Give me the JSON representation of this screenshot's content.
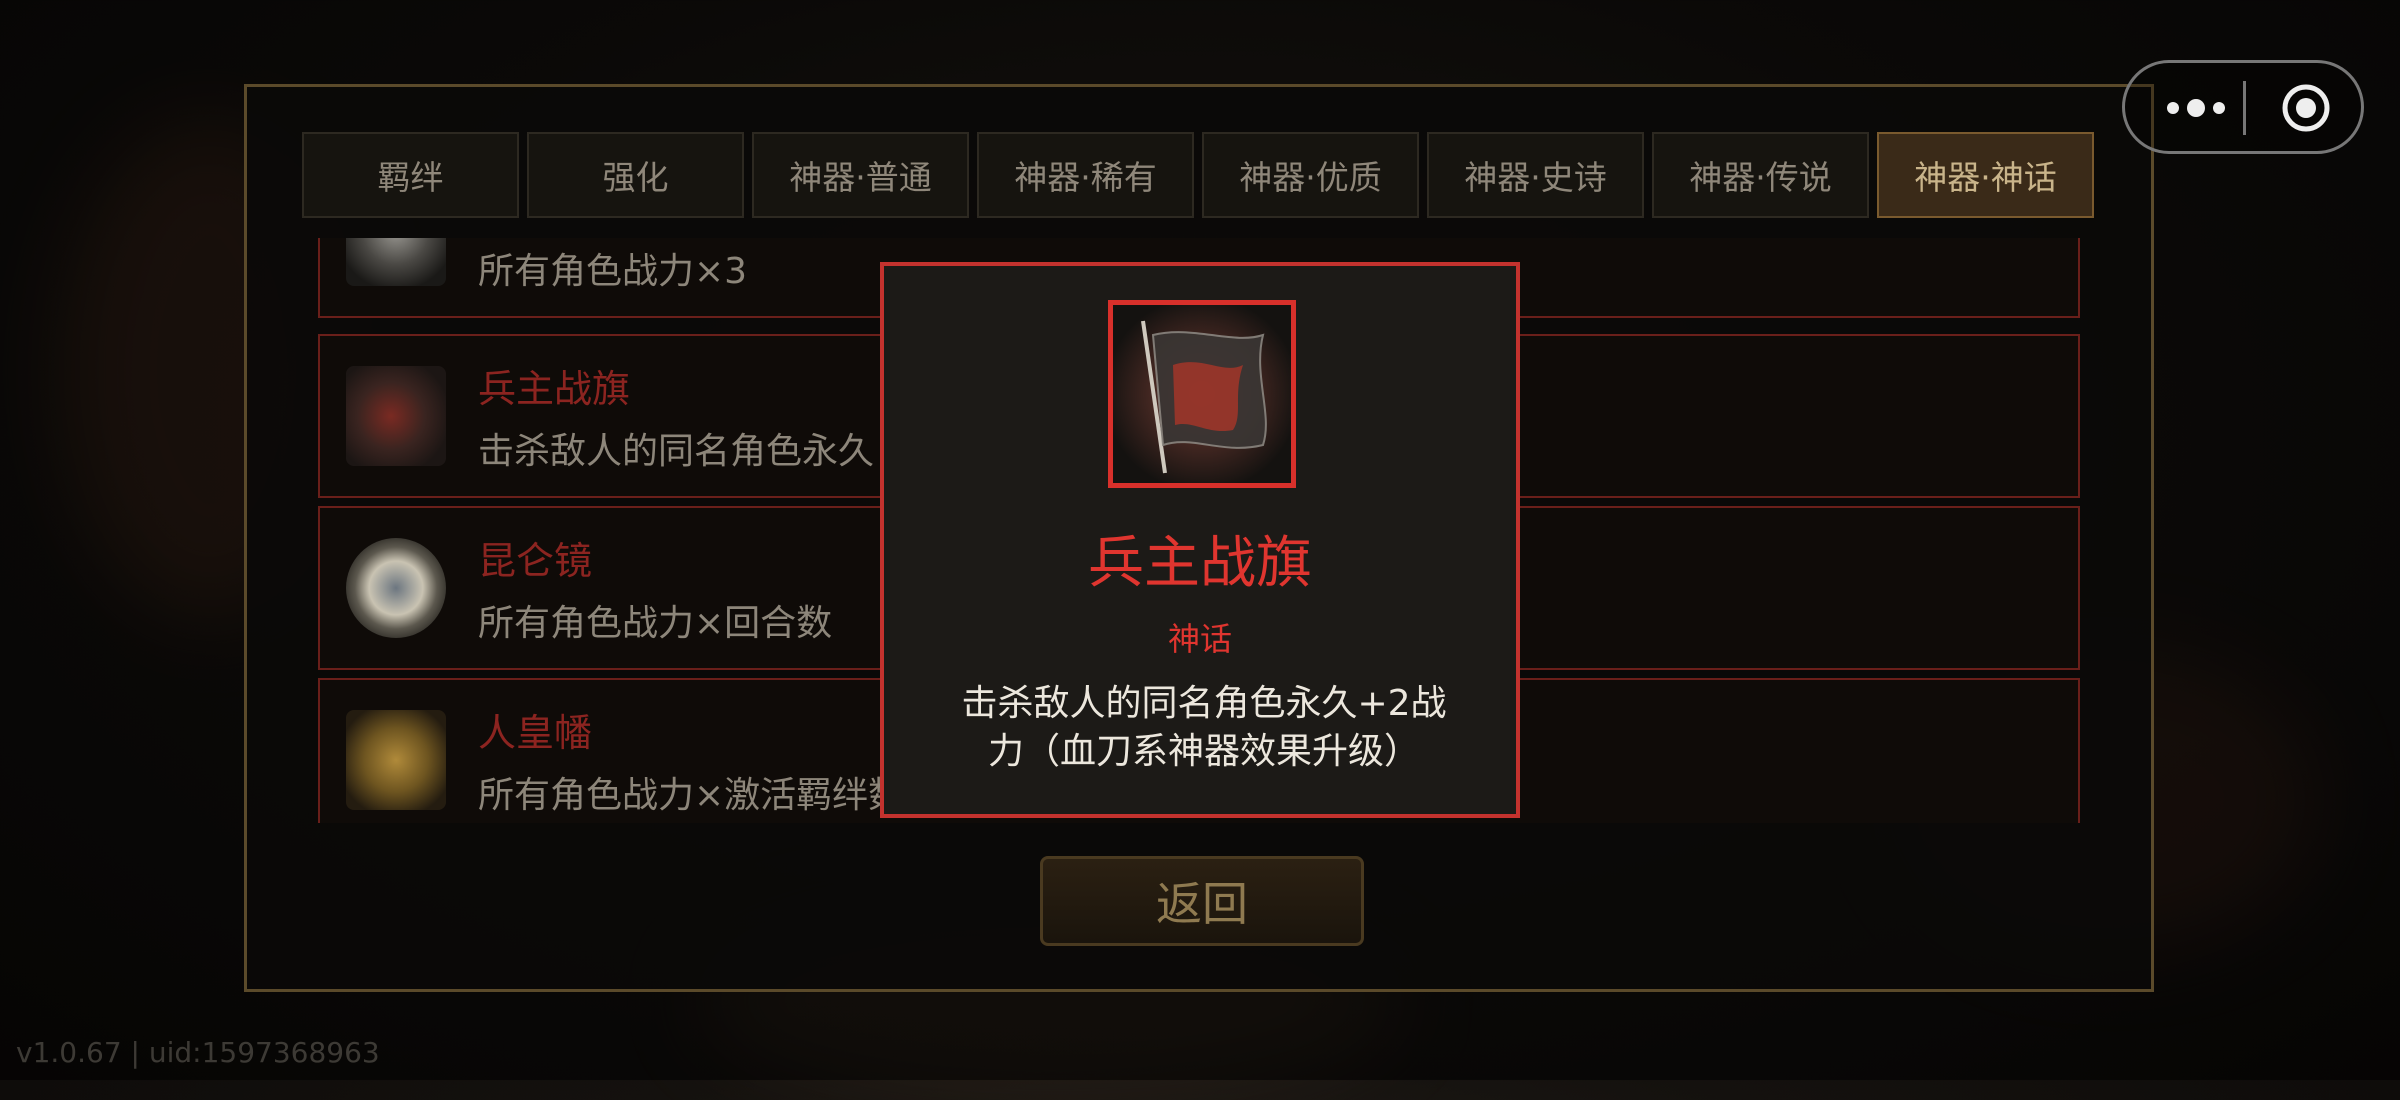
{
  "tabs": [
    {
      "label": "羁绊"
    },
    {
      "label": "强化"
    },
    {
      "label": "神器·普通"
    },
    {
      "label": "神器·稀有"
    },
    {
      "label": "神器·优质"
    },
    {
      "label": "神器·史诗"
    },
    {
      "label": "神器·传说"
    },
    {
      "label": "神器·神话",
      "active": true
    }
  ],
  "list": {
    "items": [
      {
        "name": "",
        "desc": "所有角色战力×3",
        "icon": "artifact-dragon-icon"
      },
      {
        "name": "兵主战旗",
        "desc": "击杀敌人的同名角色永久",
        "icon": "war-banner-icon"
      },
      {
        "name": "昆仑镜",
        "desc": "所有角色战力×回合数",
        "icon": "kunlun-mirror-icon"
      },
      {
        "name": "人皇幡",
        "desc": "所有角色战力×激活羁绊数",
        "icon": "emperor-banner-icon"
      }
    ]
  },
  "popup": {
    "title": "兵主战旗",
    "rarity": "神话",
    "description": "击杀敌人的同名角色永久+2战力（血刀系神器效果升级）",
    "icon": "war-banner-icon"
  },
  "return_label": "返回",
  "version": "v1.0.67 | uid:1597368963",
  "colors": {
    "accent_red": "#e0352f",
    "active_tab": "#3a2a18",
    "panel_border": "#5b4a2a"
  }
}
